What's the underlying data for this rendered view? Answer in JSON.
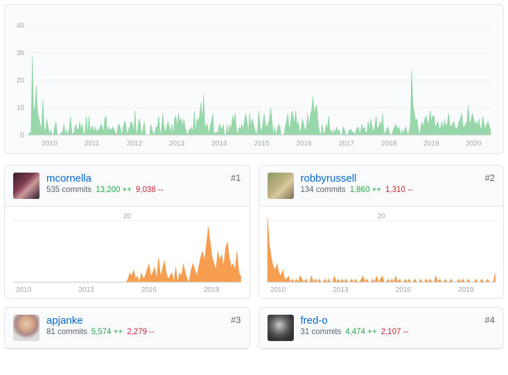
{
  "chart_data": {
    "type": "area",
    "title": "",
    "xlabel": "",
    "ylabel": "",
    "ylim": [
      0,
      44
    ],
    "y_ticks": [
      0,
      10,
      20,
      30,
      40
    ],
    "x_ticks": [
      "2010",
      "2011",
      "2012",
      "2013",
      "2014",
      "2015",
      "2016",
      "2017",
      "2018",
      "2019",
      "2020"
    ],
    "x_range": [
      2009.5,
      2020.4
    ],
    "series_color": "#85d09a",
    "values": [
      0,
      1,
      0,
      29,
      9,
      10,
      18,
      8,
      6,
      4,
      2,
      13,
      3,
      1,
      6,
      3,
      0,
      2,
      0,
      0,
      3,
      5,
      0,
      0,
      0,
      1,
      1,
      4,
      0,
      2,
      0,
      2,
      7,
      1,
      0,
      2,
      4,
      2,
      2,
      5,
      2,
      4,
      0,
      1,
      7,
      0,
      7,
      1,
      3,
      3,
      1,
      3,
      1,
      2,
      2,
      4,
      3,
      1,
      6,
      7,
      1,
      3,
      2,
      2,
      3,
      2,
      1,
      0,
      3,
      4,
      2,
      0,
      3,
      5,
      4,
      0,
      2,
      3,
      5,
      4,
      1,
      9,
      0,
      2,
      6,
      4,
      0,
      2,
      5,
      0,
      0,
      0,
      0,
      4,
      2,
      0,
      1,
      3,
      3,
      7,
      0,
      2,
      8,
      3,
      1,
      3,
      5,
      3,
      1,
      4,
      0,
      6,
      7,
      3,
      8,
      5,
      6,
      3,
      6,
      3,
      1,
      0,
      2,
      2,
      3,
      1,
      9,
      1,
      6,
      5,
      7,
      12,
      5,
      15,
      4,
      3,
      4,
      0,
      3,
      5,
      8,
      0,
      1,
      1,
      1,
      4,
      3,
      2,
      4,
      0,
      0,
      4,
      0,
      4,
      2,
      7,
      5,
      8,
      2,
      0,
      3,
      2,
      4,
      2,
      5,
      8,
      5,
      1,
      8,
      3,
      6,
      4,
      2,
      0,
      2,
      9,
      3,
      1,
      4,
      8,
      4,
      3,
      4,
      6,
      10,
      5,
      0,
      3,
      0,
      2,
      4,
      3,
      0,
      0,
      0,
      3,
      5,
      8,
      2,
      4,
      9,
      7,
      4,
      9,
      3,
      5,
      1,
      2,
      6,
      4,
      2,
      2,
      8,
      3,
      7,
      9,
      14,
      8,
      10,
      11,
      4,
      1,
      0,
      4,
      1,
      0,
      4,
      2,
      7,
      1,
      2,
      0,
      2,
      1,
      3,
      1,
      2,
      0,
      0,
      3,
      2,
      0,
      0,
      1,
      2,
      2,
      1,
      1,
      0,
      2,
      3,
      2,
      0,
      4,
      2,
      3,
      1,
      1,
      5,
      2,
      6,
      3,
      1,
      3,
      7,
      2,
      3,
      5,
      3,
      8,
      0,
      1,
      2,
      3,
      1,
      0,
      0,
      2,
      3,
      4,
      2,
      3,
      2,
      0,
      2,
      0,
      3,
      2,
      0,
      1,
      4,
      24,
      11,
      8,
      5,
      6,
      2,
      0,
      3,
      5,
      3,
      6,
      7,
      5,
      4,
      9,
      5,
      7,
      7,
      3,
      4,
      5,
      2,
      3,
      5,
      2,
      6,
      3,
      4,
      8,
      4,
      3,
      4,
      5,
      3,
      2,
      3,
      5,
      6,
      8,
      3,
      3,
      4,
      5,
      11,
      4,
      5,
      8,
      6,
      4,
      5,
      3,
      6,
      3,
      2,
      7,
      4,
      2,
      4,
      5,
      3,
      2
    ]
  },
  "contributors": [
    {
      "rank": "#1",
      "name": "mcornella",
      "commits": "535 commits",
      "adds": "13,200 ++",
      "dels": "9,038 --",
      "avatar_bg": "linear-gradient(135deg,#3a2030 0%,#7b3b4e 40%,#c99 60%,#2a1b2b 100%)",
      "series_color": "#f6923d",
      "chart": {
        "ylim": [
          0,
          22
        ],
        "y_tick": 20,
        "x_ticks": [
          "2010",
          "2013",
          "2016",
          "2019"
        ],
        "x_range": [
          2009.5,
          2020.4
        ],
        "values": [
          0,
          0,
          0,
          0,
          0,
          0,
          0,
          0,
          0,
          0,
          0,
          0,
          0,
          0,
          0,
          0,
          0,
          0,
          0,
          0,
          0,
          0,
          0,
          0,
          0,
          0,
          0,
          0,
          0,
          0,
          0,
          0,
          0,
          0,
          0,
          0,
          0,
          0,
          0,
          0,
          0,
          0,
          0,
          0,
          0,
          0,
          0,
          0,
          0,
          0,
          0,
          0,
          0,
          0,
          0,
          0,
          0,
          0,
          0,
          0,
          1,
          3,
          2,
          4,
          1,
          2,
          0,
          3,
          1,
          2,
          4,
          6,
          2,
          3,
          5,
          1,
          8,
          2,
          4,
          7,
          3,
          1,
          2,
          3,
          0,
          5,
          0,
          3,
          2,
          6,
          3,
          1,
          0,
          4,
          6,
          4,
          2,
          5,
          8,
          10,
          7,
          12,
          18,
          13,
          8,
          6,
          4,
          10,
          7,
          9,
          5,
          11,
          13,
          8,
          5,
          6,
          4,
          10,
          3,
          2
        ]
      }
    },
    {
      "rank": "#2",
      "name": "robbyrussell",
      "commits": "134 commits",
      "adds": "1,860 ++",
      "dels": "1,310 --",
      "avatar_bg": "linear-gradient(135deg,#8b9d6b 0%,#c0b080 45%,#d9c9a0 60%,#7a6b4f 100%)",
      "series_color": "#f6923d",
      "chart": {
        "ylim": [
          0,
          22
        ],
        "y_tick": 20,
        "x_ticks": [
          "2010",
          "2013",
          "2016",
          "2019"
        ],
        "x_range": [
          2009.5,
          2020.4
        ],
        "values": [
          21,
          12,
          8,
          5,
          4,
          6,
          3,
          2,
          4,
          1,
          1,
          2,
          0,
          1,
          0,
          1,
          0,
          2,
          1,
          0,
          1,
          0,
          0,
          2,
          0,
          1,
          0,
          1,
          0,
          0,
          1,
          0,
          1,
          0,
          0,
          2,
          0,
          1,
          0,
          1,
          0,
          1,
          0,
          0,
          1,
          0,
          1,
          0,
          0,
          1,
          2,
          0,
          1,
          0,
          0,
          1,
          0,
          2,
          0,
          1,
          2,
          0,
          0,
          1,
          0,
          1,
          0,
          2,
          0,
          1,
          0,
          0,
          1,
          0,
          1,
          0,
          0,
          1,
          0,
          0,
          1,
          0,
          0,
          1,
          0,
          1,
          0,
          0,
          2,
          0,
          1,
          0,
          0,
          1,
          0,
          0,
          1,
          0,
          0,
          0,
          1,
          0,
          1,
          0,
          0,
          1,
          0,
          0,
          0,
          1,
          0,
          0,
          1,
          0,
          0,
          1,
          0,
          0,
          0,
          3
        ]
      }
    },
    {
      "rank": "#3",
      "name": "apjanke",
      "commits": "81 commits",
      "adds": "5,574 ++",
      "dels": "2,279 --",
      "avatar_bg": "radial-gradient(circle at 50% 35%, #e8c9b0 0%, #d4a888 30%, #a88 50%, #ddd 70%)",
      "series_color": "#f6923d",
      "chart": null
    },
    {
      "rank": "#4",
      "name": "fred-o",
      "commits": "31 commits",
      "adds": "4,474 ++",
      "dels": "2,107 --",
      "avatar_bg": "radial-gradient(circle at 45% 40%, #ccc 0%, #888 25%, #555 45%, #333 70%)",
      "series_color": "#f6923d",
      "chart": null
    }
  ]
}
